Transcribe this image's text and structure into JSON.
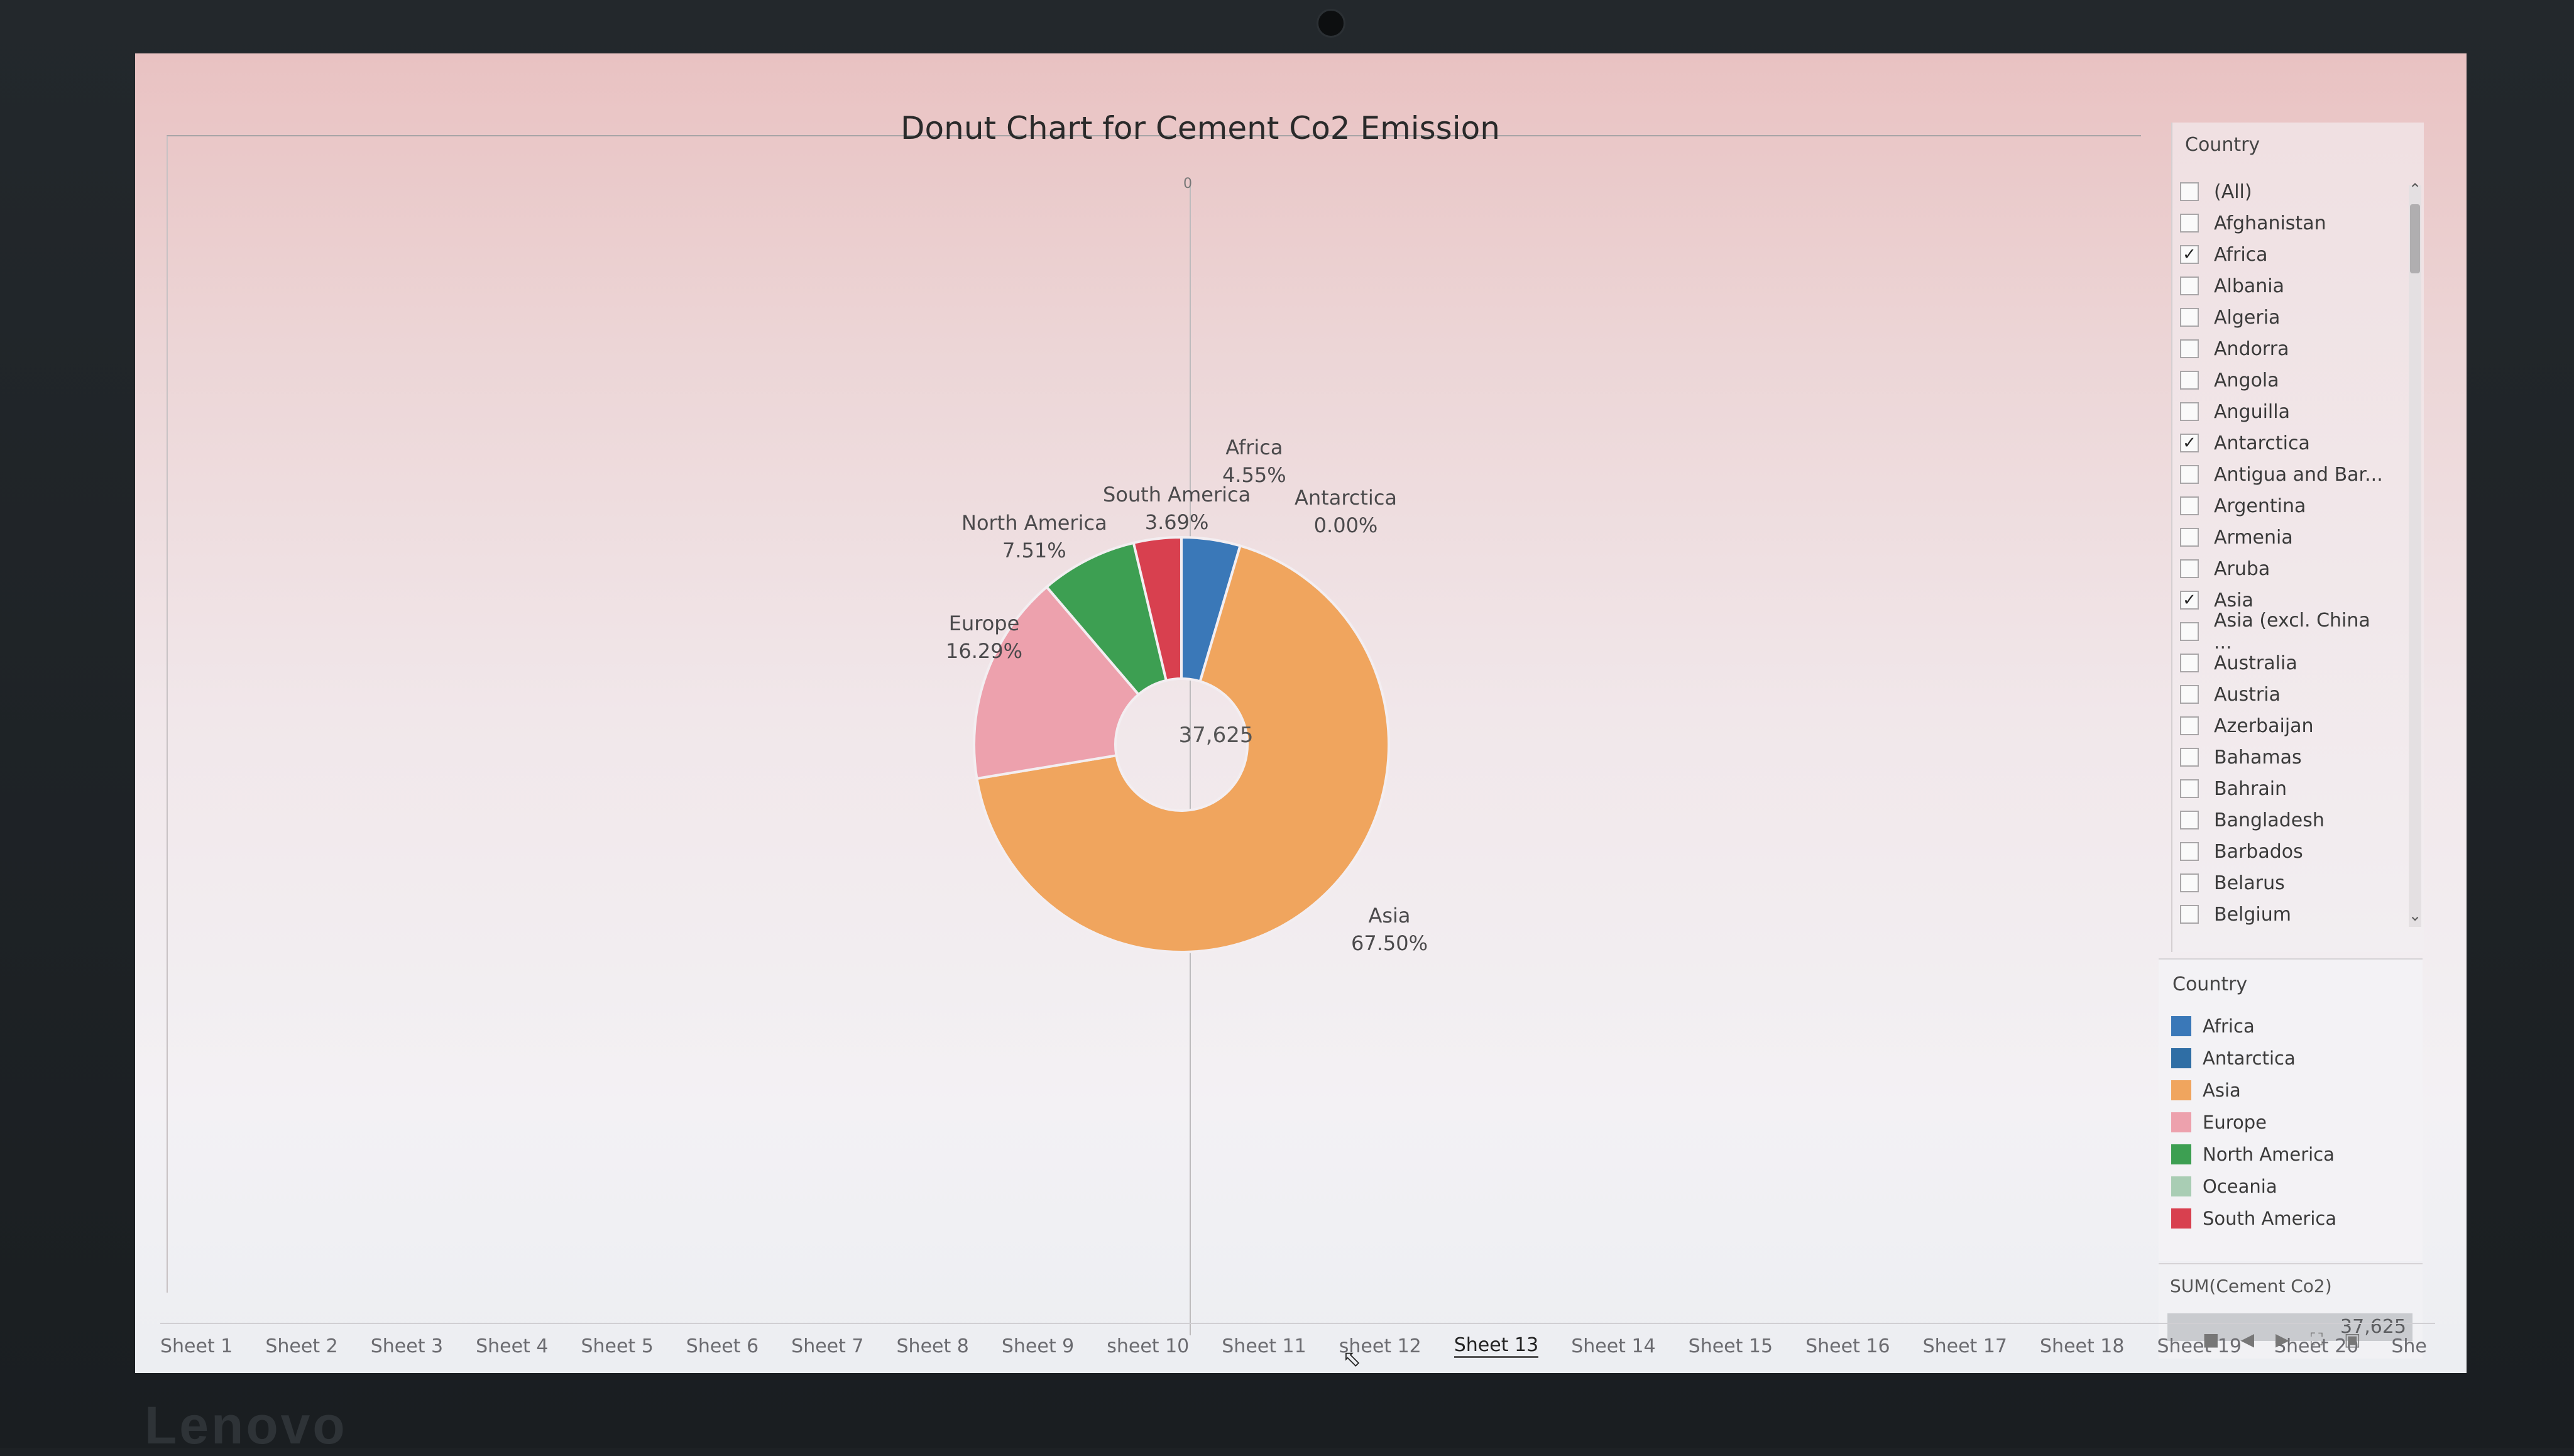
{
  "screen": {
    "chart_title": "Donut Chart for Cement Co2  Emission",
    "axis_zero_label": "0"
  },
  "chart_data": {
    "type": "pie",
    "subtype": "donut",
    "title": "Donut Chart for Cement Co2  Emission",
    "center_label": "37,625",
    "total": 37625,
    "slices": [
      {
        "name": "Asia",
        "percent": 67.5,
        "label": "67.50%",
        "color": "#f0a55e"
      },
      {
        "name": "Europe",
        "percent": 16.29,
        "label": "16.29%",
        "color": "#eda1ad"
      },
      {
        "name": "North America",
        "percent": 7.51,
        "label": "7.51%",
        "color": "#3d9f52"
      },
      {
        "name": "South America",
        "percent": 3.69,
        "label": "3.69%",
        "color": "#d8404f"
      },
      {
        "name": "Africa",
        "percent": 4.55,
        "label": "4.55%",
        "color": "#3a78b8"
      },
      {
        "name": "Antarctica",
        "percent": 0.0,
        "label": "0.00%",
        "color": "#2f6ea5"
      }
    ]
  },
  "filter": {
    "title": "Country",
    "items": [
      {
        "label": "(All)",
        "checked": false
      },
      {
        "label": "Afghanistan",
        "checked": false
      },
      {
        "label": "Africa",
        "checked": true
      },
      {
        "label": "Albania",
        "checked": false
      },
      {
        "label": "Algeria",
        "checked": false
      },
      {
        "label": "Andorra",
        "checked": false
      },
      {
        "label": "Angola",
        "checked": false
      },
      {
        "label": "Anguilla",
        "checked": false
      },
      {
        "label": "Antarctica",
        "checked": true
      },
      {
        "label": "Antigua and Bar...",
        "checked": false
      },
      {
        "label": "Argentina",
        "checked": false
      },
      {
        "label": "Armenia",
        "checked": false
      },
      {
        "label": "Aruba",
        "checked": false
      },
      {
        "label": "Asia",
        "checked": true
      },
      {
        "label": "Asia (excl. China ...",
        "checked": false
      },
      {
        "label": "Australia",
        "checked": false
      },
      {
        "label": "Austria",
        "checked": false
      },
      {
        "label": "Azerbaijan",
        "checked": false
      },
      {
        "label": "Bahamas",
        "checked": false
      },
      {
        "label": "Bahrain",
        "checked": false
      },
      {
        "label": "Bangladesh",
        "checked": false
      },
      {
        "label": "Barbados",
        "checked": false
      },
      {
        "label": "Belarus",
        "checked": false
      },
      {
        "label": "Belgium",
        "checked": false
      }
    ]
  },
  "legend": {
    "title": "Country",
    "items": [
      {
        "label": "Africa",
        "color": "#3a78b8"
      },
      {
        "label": "Antarctica",
        "color": "#2f6ea5"
      },
      {
        "label": "Asia",
        "color": "#f0a55e"
      },
      {
        "label": "Europe",
        "color": "#eda1ad"
      },
      {
        "label": "North America",
        "color": "#3d9f52"
      },
      {
        "label": "Oceania",
        "color": "#a9cdb4"
      },
      {
        "label": "South America",
        "color": "#d8404f"
      }
    ]
  },
  "measure": {
    "title": "SUM(Cement Co2)",
    "value": "37,625"
  },
  "tabs": [
    "Sheet 1",
    "Sheet 2",
    "Sheet 3",
    "Sheet 4",
    "Sheet 5",
    "Sheet 6",
    "Sheet 7",
    "Sheet 8",
    "Sheet 9",
    "sheet 10",
    "Sheet 11",
    "sheet 12",
    "Sheet 13",
    "Sheet 14",
    "Sheet 15",
    "Sheet 16",
    "Sheet 17",
    "Sheet 18",
    "Sheet 19",
    "Sheet 20",
    "She"
  ],
  "active_tab": "Sheet 13",
  "brand": "Lenovo"
}
